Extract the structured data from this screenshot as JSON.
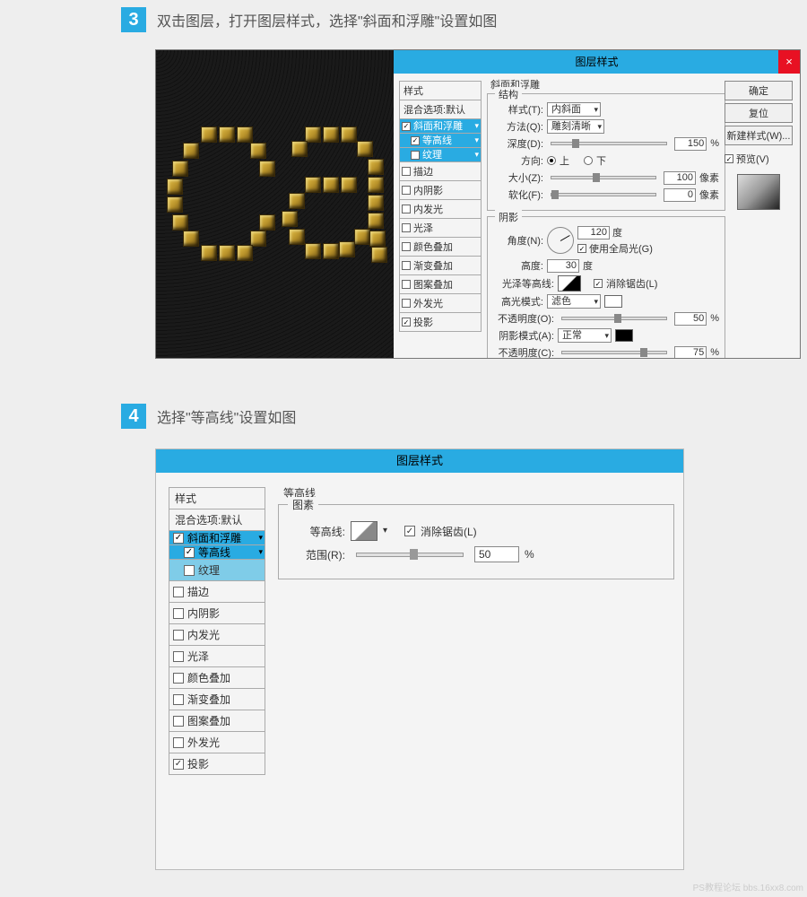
{
  "step3": {
    "num": "3",
    "text": "双击图层，打开图层样式，选择\"斜面和浮雕\"设置如图"
  },
  "step4": {
    "num": "4",
    "text": "选择\"等高线\"设置如图"
  },
  "dialog_title": "图层样式",
  "styles_header": "样式",
  "blend_opts": "混合选项:默认",
  "effects": {
    "bevel": "斜面和浮雕",
    "contour": "等高线",
    "texture": "纹理",
    "stroke": "描边",
    "inner_shadow": "内阴影",
    "inner_glow": "内发光",
    "satin": "光泽",
    "color_overlay": "颜色叠加",
    "grad_overlay": "渐变叠加",
    "pat_overlay": "图案叠加",
    "outer_glow": "外发光",
    "drop_shadow": "投影"
  },
  "bevel_panel": {
    "title": "斜面和浮雕",
    "structure": "结构",
    "style_lbl": "样式(T):",
    "style_val": "内斜面",
    "tech_lbl": "方法(Q):",
    "tech_val": "雕刻清晰",
    "depth_lbl": "深度(D):",
    "depth_val": "150",
    "pct": "%",
    "dir_lbl": "方向:",
    "up": "上",
    "down": "下",
    "size_lbl": "大小(Z):",
    "size_val": "100",
    "px": "像素",
    "soften_lbl": "软化(F):",
    "soften_val": "0",
    "shading": "阴影",
    "angle_lbl": "角度(N):",
    "angle_val": "120",
    "deg": "度",
    "global": "使用全局光(G)",
    "alt_lbl": "高度:",
    "alt_val": "30",
    "gloss_lbl": "光泽等高线:",
    "aa": "消除锯齿(L)",
    "hi_mode": "高光模式:",
    "hi_val": "滤色",
    "hi_op_lbl": "不透明度(O):",
    "hi_op": "50",
    "sh_mode": "阴影模式(A):",
    "sh_val": "正常",
    "sh_op_lbl": "不透明度(C):",
    "sh_op": "75"
  },
  "buttons": {
    "ok": "确定",
    "cancel": "复位",
    "new": "新建样式(W)...",
    "preview": "预览(V)"
  },
  "contour_panel": {
    "title": "等高线",
    "elements": "图素",
    "contour_lbl": "等高线:",
    "aa": "消除锯齿(L)",
    "range_lbl": "范围(R):",
    "range_val": "50",
    "pct": "%"
  },
  "watermark": "PS教程论坛 bbs.16xx8.com"
}
